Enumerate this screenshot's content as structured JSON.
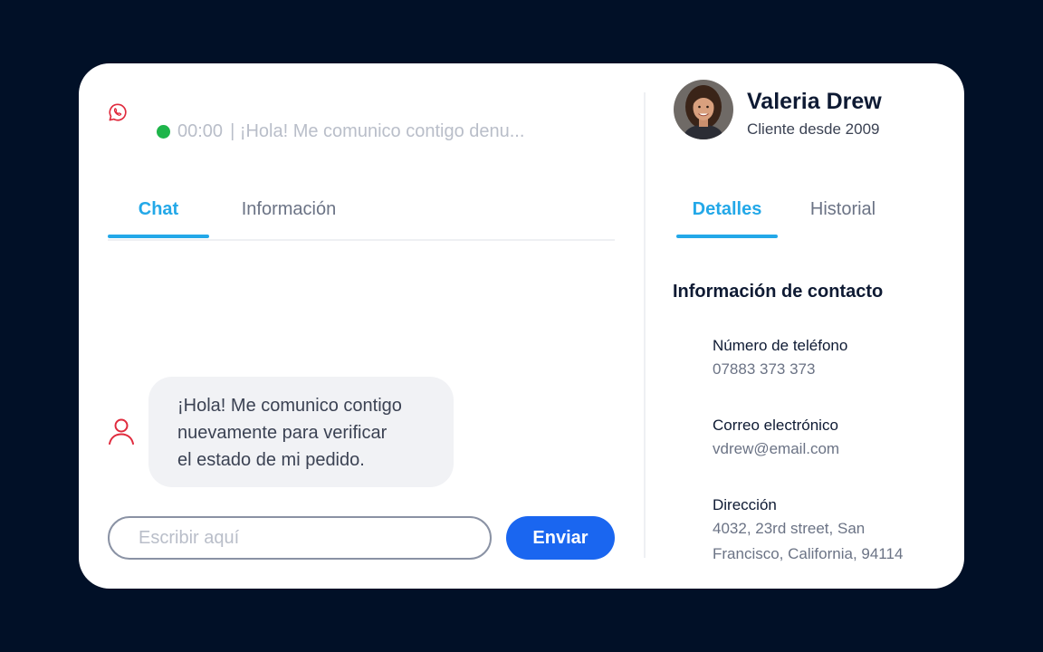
{
  "theme": {
    "accent": "#23a8e8",
    "primary_button": "#1a66f0",
    "status_online": "#1eb54a",
    "icon_red": "#e02a3d"
  },
  "conversation": {
    "channel_icon": "whatsapp-icon",
    "timer": "00:00",
    "preview": "| ¡Hola! Me comunico contigo denu..."
  },
  "left_tabs": {
    "chat": "Chat",
    "info": "Información",
    "active": "Chat"
  },
  "message": {
    "sender_icon": "user-icon",
    "lines": [
      "¡Hola! Me comunico contigo",
      "nuevamente para verificar",
      "el estado de mi pedido."
    ]
  },
  "composer": {
    "placeholder": "Escribir aquí",
    "send_label": "Enviar"
  },
  "customer": {
    "name": "Valeria Drew",
    "since": "Cliente desde 2009"
  },
  "right_tabs": {
    "details": "Detalles",
    "history": "Historial",
    "active": "Detalles"
  },
  "contact": {
    "title": "Información de contacto",
    "phone_label": "Número de teléfono",
    "phone_value": "07883 373 373",
    "email_label": "Correo electrónico",
    "email_value": "vdrew@email.com",
    "address_label": "Dirección",
    "address_lines": [
      "4032, 23rd street, San",
      "Francisco, California, 94114"
    ]
  }
}
